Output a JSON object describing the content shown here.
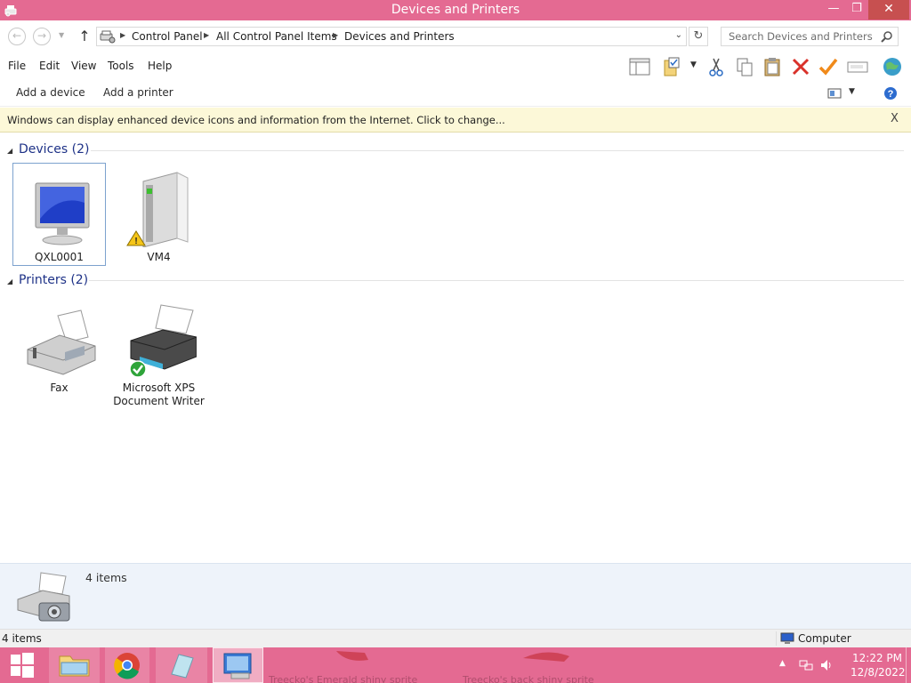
{
  "window": {
    "title": "Devices and Printers",
    "minimize": "—",
    "maximize": "❐",
    "close": "✕"
  },
  "nav": {
    "back": "←",
    "forward": "→",
    "recent": "▼",
    "up": "↑"
  },
  "address": {
    "crumbs": [
      "Control Panel",
      "All Control Panel Items",
      "Devices and Printers"
    ],
    "separator": "▶",
    "dropdown": "⌄",
    "refresh": "↻"
  },
  "search": {
    "placeholder": "Search Devices and Printers"
  },
  "menu": {
    "items": [
      "File",
      "Edit",
      "View",
      "Tools",
      "Help"
    ]
  },
  "toolbar_icons": [
    "layout-icon",
    "properties-icon",
    "cut-icon",
    "copy-icon",
    "paste-icon",
    "delete-icon",
    "checkmark-icon",
    "rename-icon",
    "globe-icon"
  ],
  "commands": {
    "add_device": "Add a device",
    "add_printer": "Add a printer",
    "view_dropdown": "▼"
  },
  "infobar": {
    "message": "Windows can display enhanced device icons and information from the Internet. Click to change...",
    "close": "X"
  },
  "groups": {
    "devices": {
      "label": "Devices (2)",
      "items": [
        {
          "label": "QXL0001",
          "icon": "monitor-icon"
        },
        {
          "label": "VM4",
          "icon": "hard-drive-icon",
          "status": "warning"
        }
      ]
    },
    "printers": {
      "label": "Printers (2)",
      "items": [
        {
          "label": "Fax",
          "icon": "fax-icon"
        },
        {
          "label": "Microsoft XPS Document Writer",
          "icon": "printer-icon",
          "status": "default"
        }
      ]
    }
  },
  "details": {
    "count": "4 items"
  },
  "status": {
    "items": "4 items",
    "location": "Computer"
  },
  "taskbar": {
    "wallpaper_text_1": "Treecko's Emerald shiny sprite",
    "wallpaper_text_2": "Treecko's back shiny sprite",
    "clock_time": "12:22 PM",
    "clock_date": "12/8/2022"
  },
  "colors": {
    "accent": "#e46a92",
    "group_header": "#1e3287",
    "infobar": "#fcf8d8",
    "details_pane": "#eef3fa"
  }
}
